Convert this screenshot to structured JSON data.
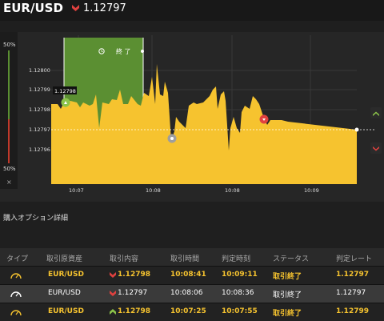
{
  "header": {
    "pair": "EUR/USD",
    "rate": "1.12797"
  },
  "chart": {
    "pct_top": "50%",
    "pct_bottom": "50%",
    "close_label": "×",
    "banner": "終 了",
    "callout": "1.12798",
    "y_ticks": [
      "1.12800",
      "1.12799",
      "1.12798",
      "1.12797",
      "1.12796"
    ],
    "x_ticks": [
      "10:07",
      "10:08",
      "10:08",
      "10:09"
    ],
    "colors": {
      "area": "#f6c32f",
      "win_zone": "#5b8f32",
      "up": "#8bc34a",
      "down": "#e0413f",
      "neutral": "#9e9e9e"
    }
  },
  "details": {
    "title": "購入オプション詳細",
    "headers": [
      "タイプ",
      "取引原資産",
      "取引内容",
      "取引時間",
      "判定時刻",
      "ステータス",
      "判定レート"
    ],
    "rows": [
      {
        "asset": "EUR/USD",
        "direction": "down",
        "entry": "1.12798",
        "time": "10:08:41",
        "judge": "10:09:11",
        "status": "取引終了",
        "rate": "1.12797"
      },
      {
        "asset": "EUR/USD",
        "direction": "down",
        "entry": "1.12797",
        "time": "10:08:06",
        "judge": "10:08:36",
        "status": "取引終了",
        "rate": "1.12797"
      },
      {
        "asset": "EUR/USD",
        "direction": "up",
        "entry": "1.12798",
        "time": "10:07:25",
        "judge": "10:07:55",
        "status": "取引終了",
        "rate": "1.12799"
      }
    ]
  }
}
